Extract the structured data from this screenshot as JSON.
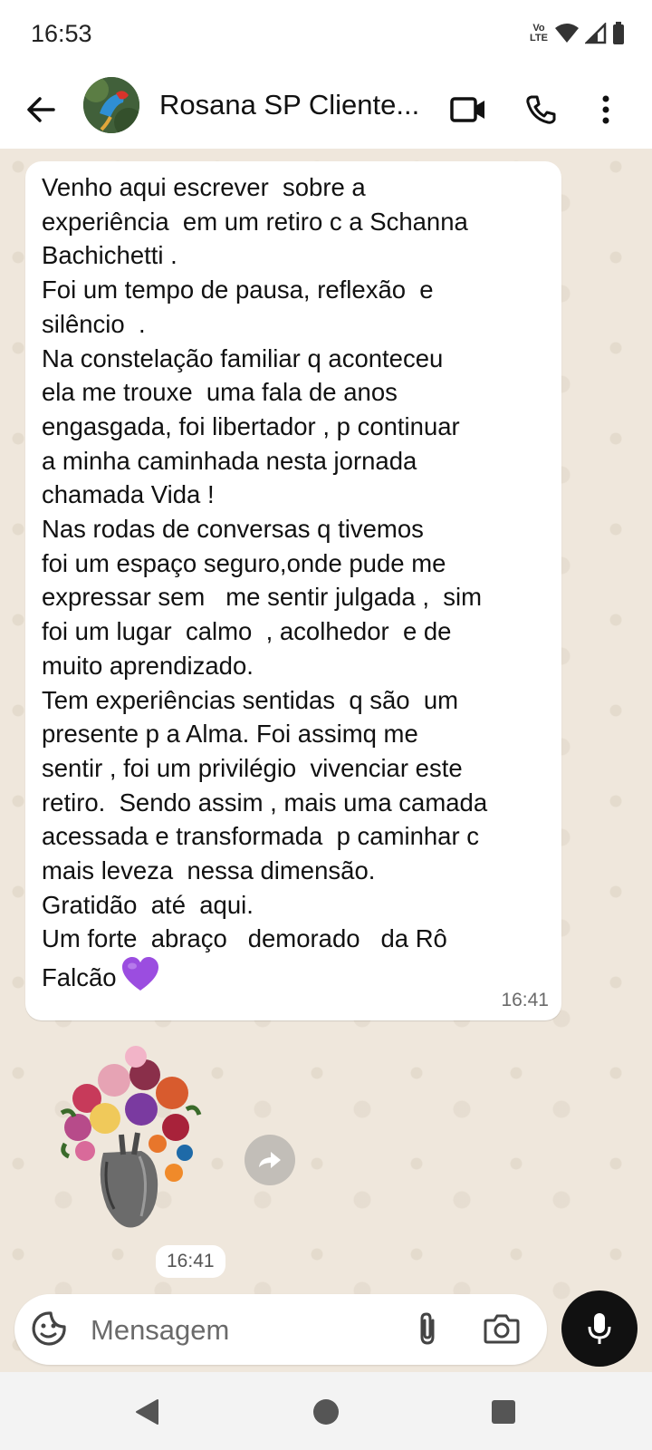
{
  "status": {
    "time": "16:53",
    "network": "Vo LTE"
  },
  "header": {
    "contact_name": "Rosana SP Cliente..."
  },
  "message": {
    "text": "Venho aqui escrever  sobre a\nexperiência  em um retiro c a Schanna\nBachichetti .\nFoi um tempo de pausa, reflexão  e\nsilêncio  .\nNa constelação familiar q aconteceu\nela me trouxe  uma fala de anos\nengasgada, foi libertador , p continuar\na minha caminhada nesta jornada\nchamada Vida !\nNas rodas de conversas q tivemos\nfoi um espaço seguro,onde pude me\nexpressar sem   me sentir julgada ,  sim\nfoi um lugar  calmo  , acolhedor  e de\nmuito aprendizado.\nTem experiências sentidas  q são  um\npresente p a Alma. Foi assimq me\nsentir , foi um privilégio  vivenciar este\nretiro.  Sendo assim , mais uma camada\nacessada e transformada  p caminhar c\nmais leveza  nessa dimensão.\nGratidão  até  aqui.\nUm forte  abraço   demorado   da Rô\nFalcão",
    "emoji": "purple-heart",
    "time": "16:41"
  },
  "sticker": {
    "icon": "floral-anatomical-heart-sticker",
    "time": "16:41"
  },
  "composer": {
    "placeholder": "Mensagem"
  },
  "colors": {
    "chat_bg": "#efe7dc",
    "bubble": "#ffffff",
    "mic_button": "#111111",
    "heart": "#9b4de0"
  }
}
